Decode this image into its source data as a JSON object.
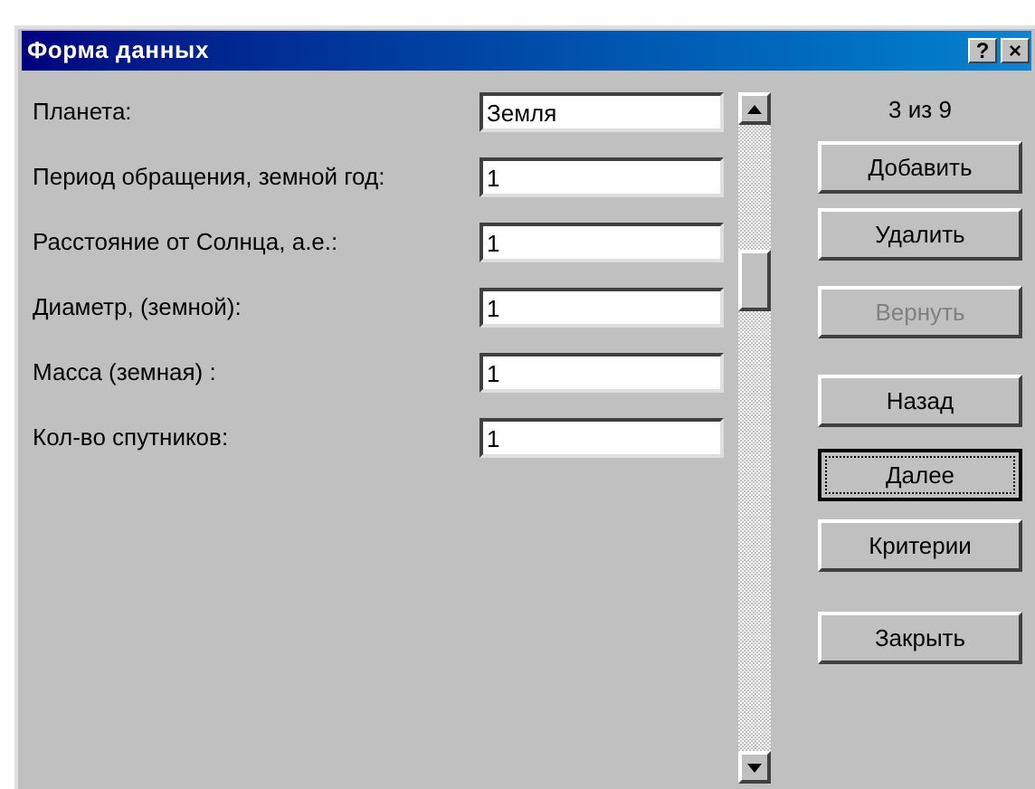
{
  "window": {
    "title": "Форма данных",
    "title_buttons": [
      "?",
      "×"
    ]
  },
  "fields": [
    {
      "label": "Планета:",
      "value": "Земля"
    },
    {
      "label": "Период обращения, земной год:",
      "value": "1"
    },
    {
      "label": "Расстояние от Солнца, а.е.:",
      "value": "1"
    },
    {
      "label": "Диаметр, (земной):",
      "value": "1"
    },
    {
      "label": "Масса (земная) :",
      "value": "1"
    },
    {
      "label": "Кол-во спутников:",
      "value": "1"
    }
  ],
  "record_counter": "3 из 9",
  "buttons": [
    {
      "label": "Добавить",
      "disabled": false,
      "focused": false
    },
    {
      "label": "Удалить",
      "disabled": false,
      "focused": false
    },
    {
      "label": "Вернуть",
      "disabled": true,
      "focused": false
    },
    {
      "label": "Назад",
      "disabled": false,
      "focused": false
    },
    {
      "label": "Далее",
      "disabled": false,
      "focused": true
    },
    {
      "label": "Критерии",
      "disabled": false,
      "focused": false
    },
    {
      "label": "Закрыть",
      "disabled": false,
      "focused": false
    }
  ]
}
